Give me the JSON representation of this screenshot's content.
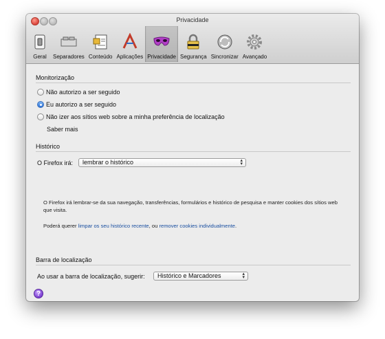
{
  "window": {
    "title": "Privacidade"
  },
  "toolbar": {
    "items": [
      {
        "label": "Geral",
        "icon": "switch-icon"
      },
      {
        "label": "Separadores",
        "icon": "tabs-icon"
      },
      {
        "label": "Conteúdo",
        "icon": "document-icon"
      },
      {
        "label": "Aplicações",
        "icon": "apps-icon"
      },
      {
        "label": "Privacidade",
        "icon": "mask-icon"
      },
      {
        "label": "Segurança",
        "icon": "lock-icon"
      },
      {
        "label": "Sincronizar",
        "icon": "sync-icon"
      },
      {
        "label": "Avançado",
        "icon": "gear-icon"
      }
    ],
    "active": "Privacidade"
  },
  "tracking": {
    "title": "Monitorização",
    "options": [
      {
        "label": "Não autorizo a ser seguido",
        "checked": false
      },
      {
        "label": "Eu autorizo a ser seguido",
        "checked": true
      },
      {
        "label": "Não izer aos sítios web sobre a minha preferência de localização",
        "checked": false
      }
    ],
    "learn_more": "Saber mais"
  },
  "history": {
    "title": "Histórico",
    "label": "O Firefox irá:",
    "selected": "lembrar o histórico",
    "description": "O Firefox irá lembrar-se da sua navegação, transferências, formulários e histórico de pesquisa e manter cookies dos sítios web que visita.",
    "may_prefix": "Poderá querer ",
    "clear_link": "limpar os seu histórico recente",
    "middle": ", ou ",
    "remove_link": "remover cookies individualmente",
    "suffix": "."
  },
  "locationbar": {
    "title": "Barra de localização",
    "label": "Ao usar a barra de localização, sugerir:",
    "selected": "Histórico e Marcadores"
  },
  "help": {
    "label": "?"
  }
}
